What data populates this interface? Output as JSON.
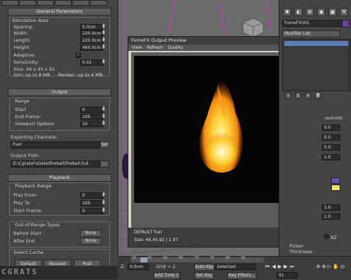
{
  "left_panel": {
    "general_parameters": {
      "header": "General Parameters",
      "simulation_area_label": "Simulation Area",
      "spacing": {
        "label": "Spacing:",
        "value": "5.0cm"
      },
      "width": {
        "label": "Width:",
        "value": "220.0cm"
      },
      "length": {
        "label": "Length:",
        "value": "220.0cm"
      },
      "height": {
        "label": "Height:",
        "value": "460.0cm"
      },
      "adaptive": {
        "label": "Adaptive:",
        "checked": true
      },
      "sensitivity": {
        "label": "Sensitivity:",
        "value": "0.01"
      },
      "size_text": "Size: 44 x 45 x 92",
      "sim_text": "Sim: up to 8 MB",
      "render_text": "Render: up to 4 MB"
    },
    "output": {
      "header": "Output",
      "range_label": "Range",
      "start": {
        "label": "Start",
        "value": "0"
      },
      "end_frame": {
        "label": "End Frame:",
        "value": "100"
      },
      "viewport_update": {
        "label": "Viewport Update:",
        "value": "10"
      },
      "exporting_channels_label": "Exporting Channels:",
      "channels_value": "Fuel",
      "set_button": "Set",
      "output_path_label": "Output Path:",
      "output_path_value": "D:\\CgratsFxData\\fireball\\fireball.fxd",
      "browse_button": "..."
    },
    "playback": {
      "header": "Playback",
      "playback_range_label": "Playback Range",
      "play_from": {
        "label": "Play From:",
        "value": "0"
      },
      "play_to": {
        "label": "Play To:",
        "value": "100"
      },
      "start_frame": {
        "label": "Start Frame:",
        "value": "0"
      },
      "out_of_range_label": "Out-of-Range Types",
      "before_start": {
        "label": "Before Start",
        "value": "None"
      },
      "after_end": {
        "label": "After End",
        "value": "None"
      },
      "select_cache_label": "Select Cache",
      "cache_buttons": [
        "Default",
        "Wavelet",
        "Post"
      ]
    }
  },
  "viewport": {
    "label": ""
  },
  "preview_window": {
    "title": "FumeFX Output Preview",
    "menu": [
      "View",
      "Refresh",
      "Quality"
    ],
    "channel_text": "DEFAULT fuel",
    "size_text": "Size: 44,45,92 | 1.97"
  },
  "right_panel": {
    "object_name": "FumeFX001",
    "modifier_list_label": "Modifier List",
    "threshold_label": "reshold:",
    "spin_values_a": [
      "0.0",
      "1.0"
    ],
    "spin_values_b": [
      "1.0",
      "1.0"
    ],
    "radio_label": "XZ",
    "flicker_label": "Ficker:",
    "thickness_label": "Thickness:",
    "swatch_colors": [
      "#6a4fa8",
      "#e8e070"
    ]
  },
  "bottom": {
    "timeline_ticks": [
      "50",
      "55",
      "60",
      "65",
      "70",
      "75",
      "80",
      "85"
    ],
    "x_label": "Z:",
    "x_value": "0.0cm",
    "grid_label": "Grid = 2",
    "auto_key": "Auto Key",
    "selected": "Selected",
    "set_key": "Set Key",
    "key_filters": "Key Filters...",
    "add_time": "Add Time 1",
    "frame_value": "91"
  },
  "logo_text": "CGRATS",
  "colors": {
    "panel": "#444444",
    "viewport": "#6b6b6b",
    "fire": "#ffcc22"
  }
}
